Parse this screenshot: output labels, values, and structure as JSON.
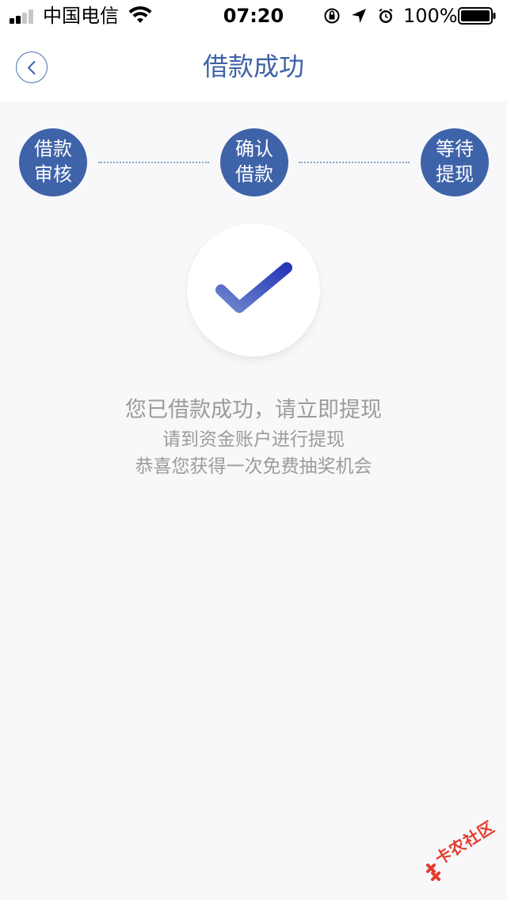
{
  "status_bar": {
    "carrier": "中国电信",
    "time": "07:20",
    "battery_percent": "100%",
    "icons": [
      "signal-icon",
      "wifi-icon",
      "orientation-lock-icon",
      "location-icon",
      "alarm-icon",
      "battery-icon"
    ]
  },
  "nav": {
    "title": "借款成功",
    "back_icon": "chevron-left-icon",
    "accent_color": "#3f63a8"
  },
  "steps": [
    {
      "line1": "借款",
      "line2": "审核"
    },
    {
      "line1": "确认",
      "line2": "借款"
    },
    {
      "line1": "等待",
      "line2": "提现"
    }
  ],
  "success": {
    "icon": "checkmark-icon",
    "main_message": "您已借款成功，请立即提现",
    "sub_message_1": "请到资金账户进行提现",
    "sub_message_2": "恭喜您获得一次免费抽奖机会"
  },
  "watermark": {
    "text": "卡农社区"
  }
}
